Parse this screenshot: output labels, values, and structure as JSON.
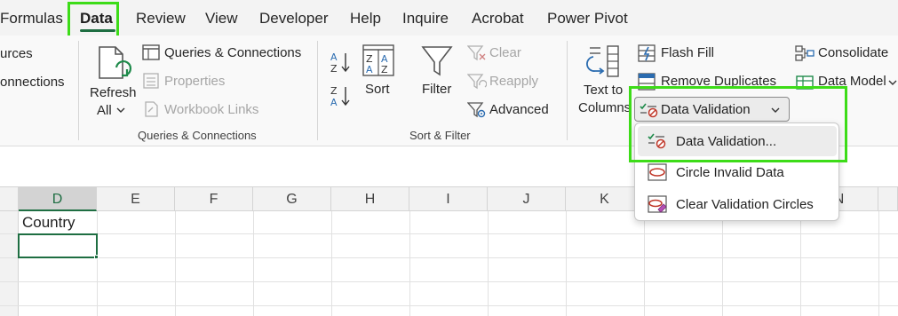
{
  "tabs": [
    {
      "label": "Formulas"
    },
    {
      "label": "Data",
      "active": true
    },
    {
      "label": "Review"
    },
    {
      "label": "View"
    },
    {
      "label": "Developer"
    },
    {
      "label": "Help"
    },
    {
      "label": "Inquire"
    },
    {
      "label": "Acrobat"
    },
    {
      "label": "Power Pivot"
    }
  ],
  "ribbon": {
    "get_data": {
      "sources_label": "urces",
      "connections_label": "onnections"
    },
    "queries": {
      "refresh_line1": "Refresh",
      "refresh_line2": "All",
      "queries_connections": "Queries & Connections",
      "properties": "Properties",
      "workbook_links": "Workbook Links",
      "group_label": "Queries & Connections"
    },
    "sort_filter": {
      "sort": "Sort",
      "filter": "Filter",
      "clear": "Clear",
      "reapply": "Reapply",
      "advanced": "Advanced",
      "group_label": "Sort & Filter"
    },
    "data_tools": {
      "text_to_line1": "Text to",
      "text_to_line2": "Columns",
      "flash_fill": "Flash Fill",
      "remove_duplicates": "Remove Duplicates",
      "data_validation": "Data Validation",
      "consolidate": "Consolidate",
      "data_model": "Data Model"
    }
  },
  "dropdown": {
    "items": [
      {
        "label": "Data Validation..."
      },
      {
        "label": "Circle Invalid Data"
      },
      {
        "label": "Clear Validation Circles"
      }
    ]
  },
  "grid": {
    "columns": [
      "D",
      "E",
      "F",
      "G",
      "H",
      "I",
      "J",
      "K",
      "N"
    ],
    "selected_column": "D",
    "cell_d1": "Country"
  },
  "colors": {
    "accent_green": "#1e6e42",
    "highlight": "#3ddc18"
  }
}
